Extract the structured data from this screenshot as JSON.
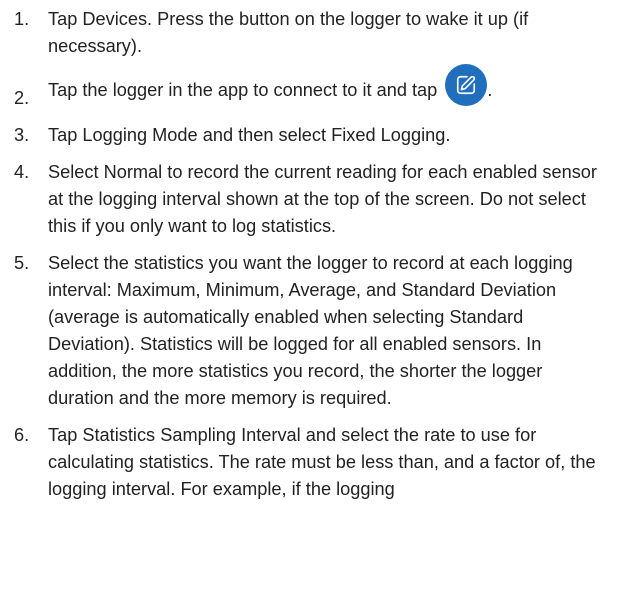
{
  "steps": [
    {
      "number": "1.",
      "text": "Tap Devices. Press the button on the logger to wake it up (if necessary)."
    },
    {
      "number": "2.",
      "text_before": "Tap the logger in the app to connect to it and tap",
      "icon": "edit-pencil-icon",
      "text_after": "."
    },
    {
      "number": "3.",
      "text": "Tap Logging Mode and then select Fixed Logging."
    },
    {
      "number": "4.",
      "text": "Select Normal to record the current reading for each enabled sensor at the logging interval shown at the top of the screen. Do not select this if you only want to log statistics."
    },
    {
      "number": "5.",
      "text": "Select the statistics you want the logger to record at each logging interval: Maximum, Minimum, Average, and Standard Deviation (average is automatically enabled when selecting Standard Deviation). Statistics will be logged for all enabled sensors. In addition, the more statistics you record, the shorter the logger duration and the more memory is required."
    },
    {
      "number": "6.",
      "text": "Tap Statistics Sampling Interval and select the rate to use for calculating statistics. The rate must be less than, and a factor of, the logging interval. For example, if the logging"
    }
  ],
  "colors": {
    "text": "#222222",
    "icon_button": "#1f6fbd",
    "icon_glyph": "#ffffff"
  }
}
